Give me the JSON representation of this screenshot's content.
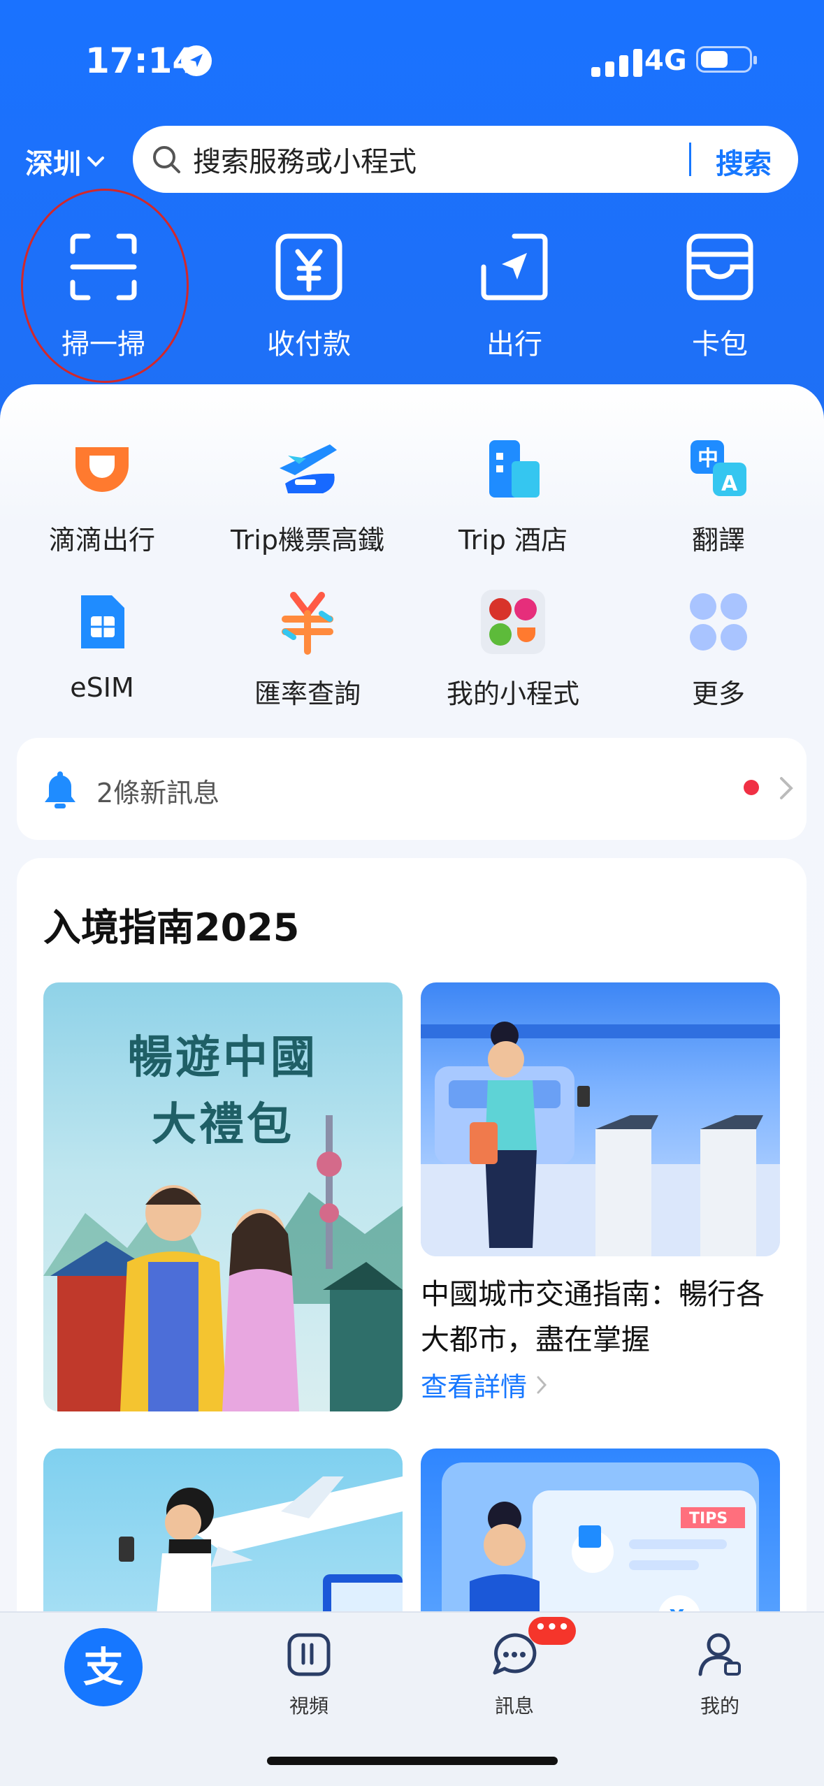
{
  "status": {
    "time": "17:14",
    "network": "4G"
  },
  "header": {
    "city": "深圳",
    "search_placeholder": "搜索服務或小程式",
    "search_button": "搜索"
  },
  "quick_actions": [
    {
      "label": "掃一掃",
      "icon": "scan-icon"
    },
    {
      "label": "收付款",
      "icon": "payment-icon"
    },
    {
      "label": "出行",
      "icon": "transit-icon"
    },
    {
      "label": "卡包",
      "icon": "wallet-icon"
    }
  ],
  "apps": [
    {
      "label": "滴滴出行",
      "icon": "didi-icon"
    },
    {
      "label": "Trip機票高鐵",
      "icon": "flight-train-icon"
    },
    {
      "label": "Trip 酒店",
      "icon": "hotel-icon"
    },
    {
      "label": "翻譯",
      "icon": "translate-icon"
    },
    {
      "label": "eSIM",
      "icon": "esim-icon"
    },
    {
      "label": "匯率查詢",
      "icon": "exchange-rate-icon"
    },
    {
      "label": "我的小程式",
      "icon": "mini-program-icon"
    },
    {
      "label": "更多",
      "icon": "more-grid-icon"
    }
  ],
  "notice": {
    "text": "2條新訊息"
  },
  "guide": {
    "title": "入境指南2025",
    "banner_line1": "暢遊中國",
    "banner_line2": "大禮包",
    "article_title": "中國城市交通指南：暢行各大都市，盡在掌握",
    "article_link": "查看詳情",
    "tips_label": "TIPS"
  },
  "tabbar": {
    "items": [
      {
        "label": "視頻"
      },
      {
        "label": "訊息"
      },
      {
        "label": "我的"
      }
    ],
    "message_badge": "•••"
  },
  "colors": {
    "brand": "#1677ff",
    "header": "#1a72ff",
    "badge": "#f5352b",
    "annotation_ring": "#d1282b"
  }
}
